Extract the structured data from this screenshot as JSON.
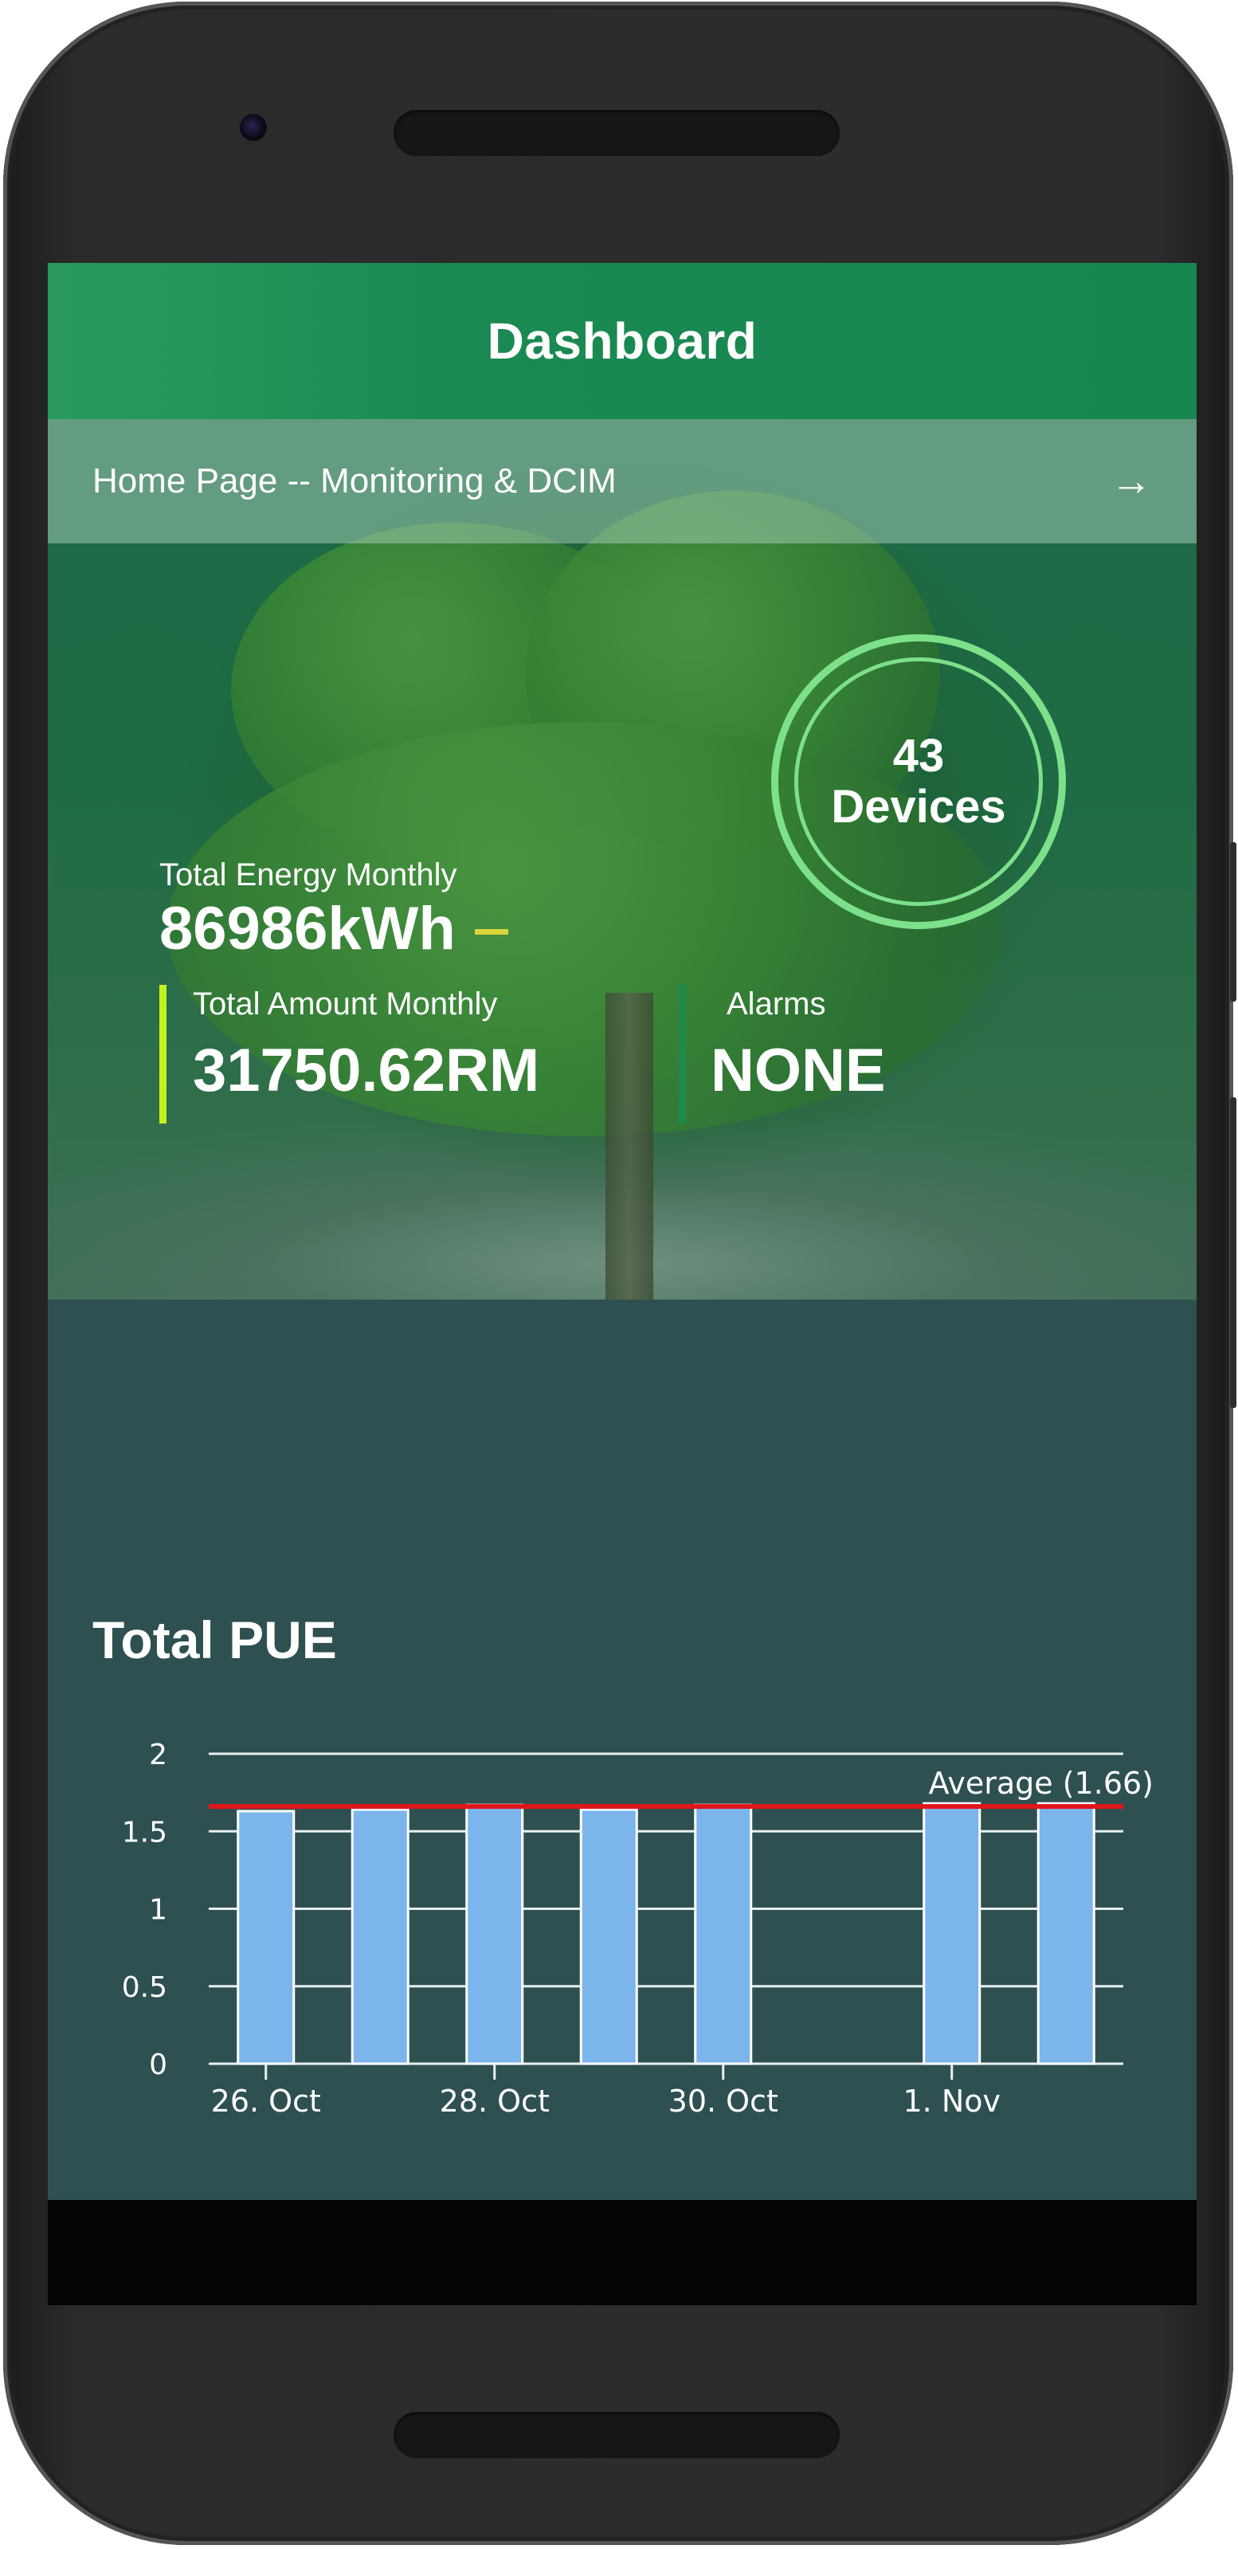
{
  "appbar": {
    "title": "Dashboard"
  },
  "breadcrumb": {
    "text": "Home Page -- Monitoring & DCIM",
    "arrow_icon": "arrow-right-icon"
  },
  "energy": {
    "label": "Total Energy Monthly",
    "value": "86986kWh"
  },
  "devices": {
    "count": "43",
    "label": "Devices"
  },
  "amount": {
    "label": "Total Amount Monthly",
    "value": "31750.62RM"
  },
  "alarms": {
    "label": "Alarms",
    "value": "NONE"
  },
  "colors": {
    "appbar": "#1a8a52",
    "card": "#2f5050",
    "bar": "#7cb5ec",
    "average_line": "#e0161a",
    "ring": "#7de08a",
    "amount_accent": "#c2f21e",
    "alarms_accent": "#1f8a4a",
    "energy_dash": "#d9d53a"
  },
  "pue": {
    "title": "Total PUE"
  },
  "chart_data": {
    "type": "bar",
    "title": "Total PUE",
    "xlabel": "",
    "ylabel": "",
    "x_tick_labels": [
      "26. Oct",
      "28. Oct",
      "30. Oct",
      "1. Nov"
    ],
    "y_tick_labels": [
      "0",
      "0.5",
      "1",
      "1.5",
      "2"
    ],
    "ylim": [
      0,
      2
    ],
    "grid": true,
    "legend": "none",
    "series": [
      {
        "categories": [
          "26. Oct",
          "27. Oct",
          "28. Oct",
          "29. Oct",
          "30. Oct",
          "31. Oct",
          "1. Nov",
          "2. Nov"
        ],
        "values": [
          1.63,
          1.64,
          1.67,
          1.64,
          1.67,
          null,
          1.68,
          1.68
        ]
      }
    ],
    "plot_lines": [
      {
        "label": "Average (1.66)",
        "value": 1.66
      }
    ]
  }
}
